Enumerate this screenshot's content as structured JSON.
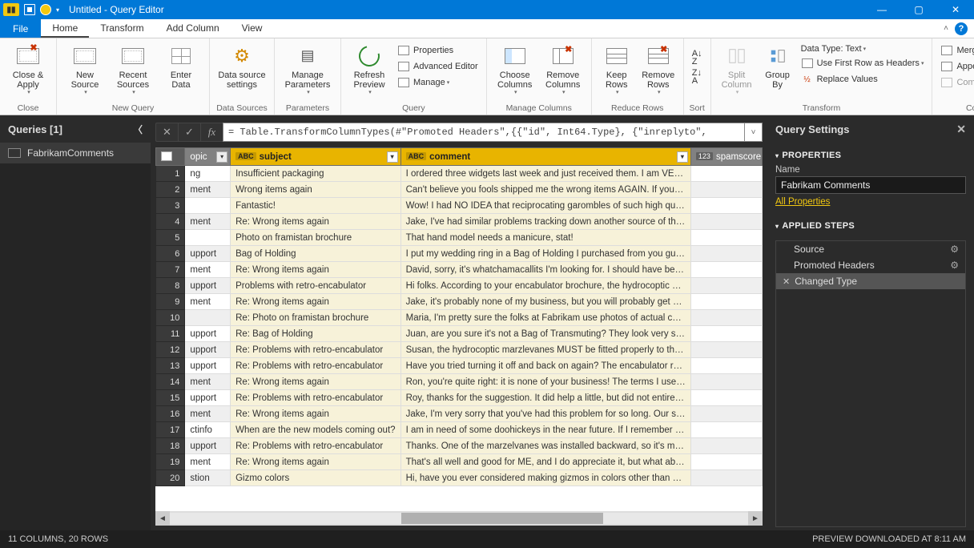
{
  "window": {
    "title": "Untitled - Query Editor"
  },
  "tabs": {
    "file": "File",
    "home": "Home",
    "transform": "Transform",
    "addcolumn": "Add Column",
    "view": "View"
  },
  "ribbon": {
    "close": {
      "close_apply": "Close &\nApply",
      "group": "Close"
    },
    "newquery": {
      "new_source": "New\nSource",
      "recent_sources": "Recent\nSources",
      "enter_data": "Enter\nData",
      "group": "New Query"
    },
    "datasources": {
      "ds_settings": "Data source\nsettings",
      "group": "Data Sources"
    },
    "parameters": {
      "manage_params": "Manage\nParameters",
      "group": "Parameters"
    },
    "query": {
      "refresh": "Refresh\nPreview",
      "properties": "Properties",
      "adv_editor": "Advanced Editor",
      "manage": "Manage",
      "group": "Query"
    },
    "managecols": {
      "choose": "Choose\nColumns",
      "remove": "Remove\nColumns",
      "group": "Manage Columns"
    },
    "reducerows": {
      "keep": "Keep\nRows",
      "remove": "Remove\nRows",
      "group": "Reduce Rows"
    },
    "sort": {
      "group": "Sort"
    },
    "splitgroup": {
      "split": "Split\nColumn",
      "groupby": "Group\nBy"
    },
    "transform": {
      "datatype": "Data Type: Text",
      "firstrow": "Use First Row as Headers",
      "replace": "Replace Values",
      "group": "Transform"
    },
    "combine": {
      "merge": "Merge Queries",
      "append": "Append Queries",
      "combinefiles": "Combine Files",
      "group": "Combine"
    }
  },
  "queries": {
    "title": "Queries [1]",
    "items": [
      {
        "name": "FabrikamComments"
      }
    ]
  },
  "formula": "= Table.TransformColumnTypes(#\"Promoted Headers\",{{\"id\", Int64.Type}, {\"inreplyto\",",
  "columns": {
    "topic": "opic",
    "subject": "subject",
    "comment": "comment",
    "spamscore": "spamscore",
    "type_text": "ABC",
    "type_num": "123"
  },
  "rows": [
    {
      "n": 1,
      "topic": "ng",
      "subject": "Insufficient packaging",
      "comment": "I ordered three widgets last week and just received them. I am VERY di..."
    },
    {
      "n": 2,
      "topic": "ment",
      "subject": "Wrong items again",
      "comment": "Can't believe you fools shipped me the wrong items AGAIN. If you wer..."
    },
    {
      "n": 3,
      "topic": "",
      "subject": "Fantastic!",
      "comment": "Wow! I had NO IDEA that reciprocating garombles of such high quality ..."
    },
    {
      "n": 4,
      "topic": "ment",
      "subject": "Re: Wrong items again",
      "comment": "Jake, I've had similar problems tracking down another source of thinga..."
    },
    {
      "n": 5,
      "topic": "",
      "subject": "Photo on framistan brochure",
      "comment": "That hand model needs a manicure, stat!"
    },
    {
      "n": 6,
      "topic": "upport",
      "subject": "Bag of Holding",
      "comment": "I put my wedding ring in a Bag of Holding I purchased from you guys (f..."
    },
    {
      "n": 7,
      "topic": "ment",
      "subject": "Re: Wrong items again",
      "comment": "David, sorry, it's whatchamacallits I'm looking for. I should have been ..."
    },
    {
      "n": 8,
      "topic": "upport",
      "subject": "Problems with retro-encabulator",
      "comment": "Hi folks. According to your encabulator brochure, the hydrocoptic mar..."
    },
    {
      "n": 9,
      "topic": "ment",
      "subject": "Re: Wrong items again",
      "comment": "Jake, it's probably none of my business, but you will probably get a bet..."
    },
    {
      "n": 10,
      "topic": "",
      "subject": "Re: Photo on framistan brochure",
      "comment": "Maria, I'm pretty sure the folks at Fabrikam use photos of actual custo..."
    },
    {
      "n": 11,
      "topic": "upport",
      "subject": "Re: Bag of Holding",
      "comment": "Juan, are you sure it's not a Bag of Transmuting? They look very simila..."
    },
    {
      "n": 12,
      "topic": "upport",
      "subject": "Re: Problems with retro-encabulator",
      "comment": "Susan, the hydrocoptic marzlevanes MUST be fitted properly to the a..."
    },
    {
      "n": 13,
      "topic": "upport",
      "subject": "Re: Problems with retro-encabulator",
      "comment": "Have you tried turning it off and back on again? The encabulator runs ..."
    },
    {
      "n": 14,
      "topic": "ment",
      "subject": "Re: Wrong items again",
      "comment": "Ron, you're quite right: it is none of your business! The terms I used ar..."
    },
    {
      "n": 15,
      "topic": "upport",
      "subject": "Re: Problems with retro-encabulator",
      "comment": "Roy, thanks for the suggestion. It did help a little, but did not entirely e..."
    },
    {
      "n": 16,
      "topic": "ment",
      "subject": "Re: Wrong items again",
      "comment": "Jake, I'm very sorry that you've had this problem for so long. Our syste..."
    },
    {
      "n": 17,
      "topic": "ctinfo",
      "subject": "When are the new models coming out?",
      "comment": "I am in need of some doohickeys in the near future. If I remember corr..."
    },
    {
      "n": 18,
      "topic": "upport",
      "subject": "Re: Problems with retro-encabulator",
      "comment": "Thanks. One of the marzelvanes was installed backward, so it's my faul..."
    },
    {
      "n": 19,
      "topic": "ment",
      "subject": "Re: Wrong items again",
      "comment": "That's all well and good for ME, and I do appreciate it, but what about ..."
    },
    {
      "n": 20,
      "topic": "stion",
      "subject": "Gizmo colors",
      "comment": "Hi, have you ever considered making gizmos in colors other than chart..."
    }
  ],
  "settings": {
    "title": "Query Settings",
    "properties": "PROPERTIES",
    "name_label": "Name",
    "name_value": "Fabrikam Comments",
    "all_props": "All Properties",
    "applied_steps": "APPLIED STEPS",
    "steps": [
      {
        "name": "Source",
        "gear": true
      },
      {
        "name": "Promoted Headers",
        "gear": true
      },
      {
        "name": "Changed Type",
        "gear": false,
        "selected": true
      }
    ]
  },
  "status": {
    "left": "11 COLUMNS, 20 ROWS",
    "right": "PREVIEW DOWNLOADED AT 8:11 AM"
  }
}
